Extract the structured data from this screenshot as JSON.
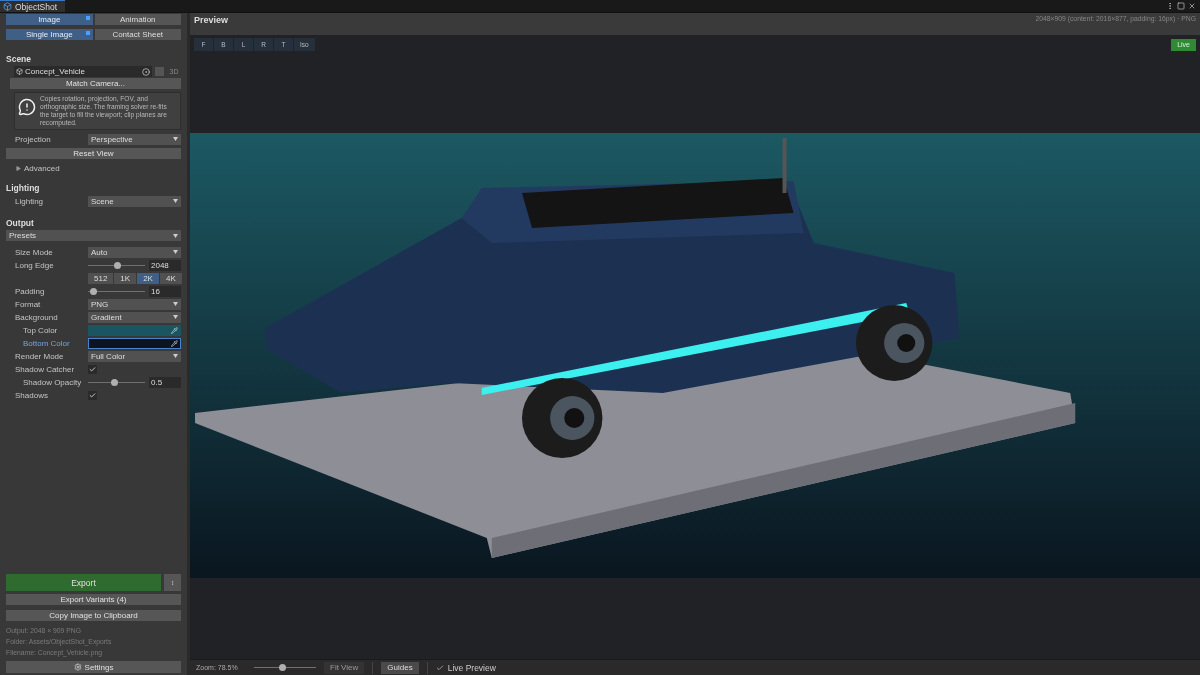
{
  "window": {
    "title": "ObjectShot"
  },
  "mode_tabs": [
    {
      "label": "Image",
      "selected": true
    },
    {
      "label": "Animation",
      "selected": false
    }
  ],
  "capture_tabs": [
    {
      "label": "Single Image",
      "selected": true
    },
    {
      "label": "Contact Sheet",
      "selected": false
    }
  ],
  "scene": {
    "heading": "Scene",
    "object_value": "Concept_Vehicle",
    "badge": "3D",
    "match_button": "Match Camera...",
    "help": "Copies rotation, projection, FOV, and orthographic size. The framing solver re-fits the target to fill the viewport; clip planes are recomputed.",
    "projection": {
      "label": "Projection",
      "value": "Perspective"
    },
    "reset_button": "Reset View",
    "advanced": {
      "label": "Advanced",
      "expanded": false
    }
  },
  "lighting": {
    "heading": "Lighting",
    "label": "Lighting",
    "value": "Scene"
  },
  "output": {
    "heading": "Output",
    "presets": "Presets",
    "rows": [
      {
        "kind": "dropdown",
        "label": "Size Mode",
        "value": "Auto"
      },
      {
        "kind": "slider",
        "label": "Long Edge",
        "level": 0.5,
        "value": "2048"
      },
      {
        "kind": "segments",
        "options": [
          {
            "label": "512",
            "selected": false
          },
          {
            "label": "1K",
            "selected": false
          },
          {
            "label": "2K",
            "selected": true
          },
          {
            "label": "4K",
            "selected": false
          }
        ]
      },
      {
        "kind": "slider",
        "label": "Padding",
        "level": 0.08,
        "value": "16"
      },
      {
        "kind": "dropdown",
        "label": "Format",
        "value": "PNG"
      },
      {
        "kind": "dropdown",
        "label": "Background",
        "value": "Gradient",
        "children": [
          {
            "kind": "color",
            "label": "Top Color",
            "color": "#1b5561",
            "focused": false
          },
          {
            "kind": "color",
            "label": "Bottom Color",
            "color": "#0b1420",
            "focused": true
          }
        ]
      },
      {
        "kind": "dropdown",
        "label": "Render Mode",
        "value": "Full Color"
      },
      {
        "kind": "checkbox",
        "label": "Shadow Catcher",
        "checked": true,
        "children": [
          {
            "kind": "slider",
            "label": "Shadow Opacity",
            "level": 0.45,
            "value": "0.5"
          }
        ]
      },
      {
        "kind": "checkbox",
        "label": "Shadows",
        "checked": true
      }
    ]
  },
  "export": {
    "button": "Export",
    "variants": "Export Variants (4)",
    "copy": "Copy Image to Clipboard",
    "info": [
      "Output: 2048 × 909 PNG",
      "Folder: Assets/ObjectShot_Exports",
      "Filename: Concept_Vehicle.png"
    ],
    "settings": "Settings"
  },
  "preview": {
    "title": "Preview",
    "info": "2048×909 (content: 2016×877, padding: 16px) · PNG",
    "views": [
      "F",
      "B",
      "L",
      "R",
      "T",
      "Iso"
    ],
    "live": "Live"
  },
  "status_bar": {
    "zoom": "Zoom: 78.5%",
    "zoom_slider": {
      "level": 0.45
    },
    "fit_view": {
      "label": "Fit View",
      "disabled": true
    },
    "guides": "Guides",
    "live_preview": {
      "label": "Live Preview",
      "checked": true
    }
  }
}
